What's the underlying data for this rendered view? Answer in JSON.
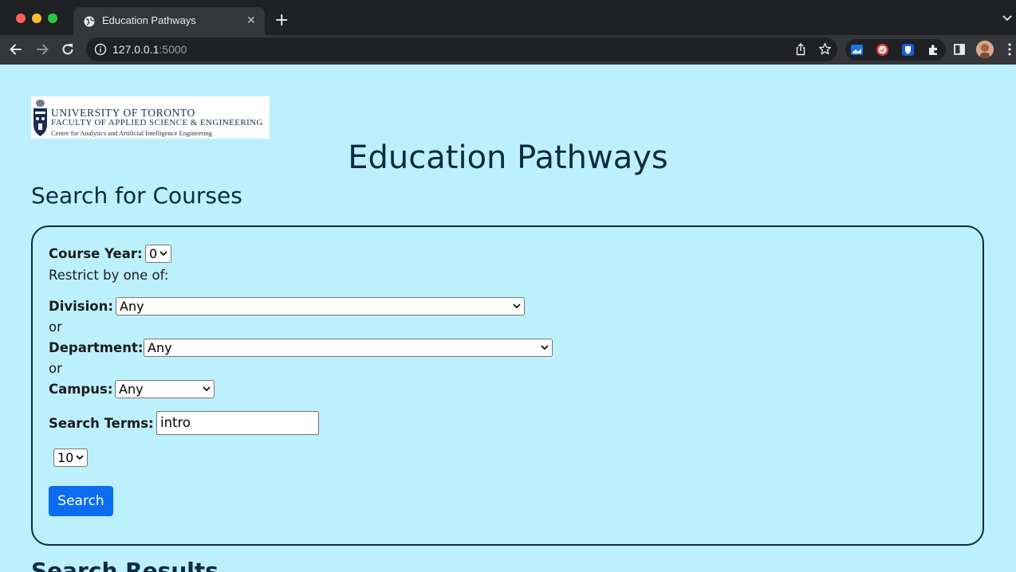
{
  "browser": {
    "tab_title": "Education Pathways",
    "tab_close_glyph": "✕",
    "new_tab_glyph": "+",
    "url_host": "127.0.0.1",
    "url_port": ":5000",
    "icons": [
      "back-icon",
      "forward-icon",
      "reload-icon",
      "info-icon",
      "share-icon",
      "bookmark-star-icon",
      "puzzle-extensions-icon",
      "side-panel-icon",
      "profile-avatar",
      "menu-dots-icon"
    ]
  },
  "logo": {
    "line1": "UNIVERSITY OF TORONTO",
    "line2": "FACULTY OF APPLIED SCIENCE & ENGINEERING",
    "line3": "Centre for Analytics and Artificial Intelligence Engineering"
  },
  "header": {
    "site_title": "Education Pathways",
    "section_title": "Search for Courses"
  },
  "search_form": {
    "course_year_label": "Course Year:",
    "course_year_value": "0",
    "restrict_text": "Restrict by one of:",
    "division_label": "Division:",
    "division_value": "Any",
    "or_1": "or",
    "department_label": "Department:",
    "department_value": "Any",
    "or_2": "or",
    "campus_label": "Campus:",
    "campus_value": "Any",
    "search_terms_label": "Search Terms:",
    "search_terms_value": "intro",
    "results_count_value": "10",
    "search_button": "Search"
  },
  "results": {
    "title": "Search Results"
  },
  "colors": {
    "page_background": "#bdf0fd",
    "heading_text": "#0d2a44",
    "button_blue": "#0b6cf2"
  }
}
